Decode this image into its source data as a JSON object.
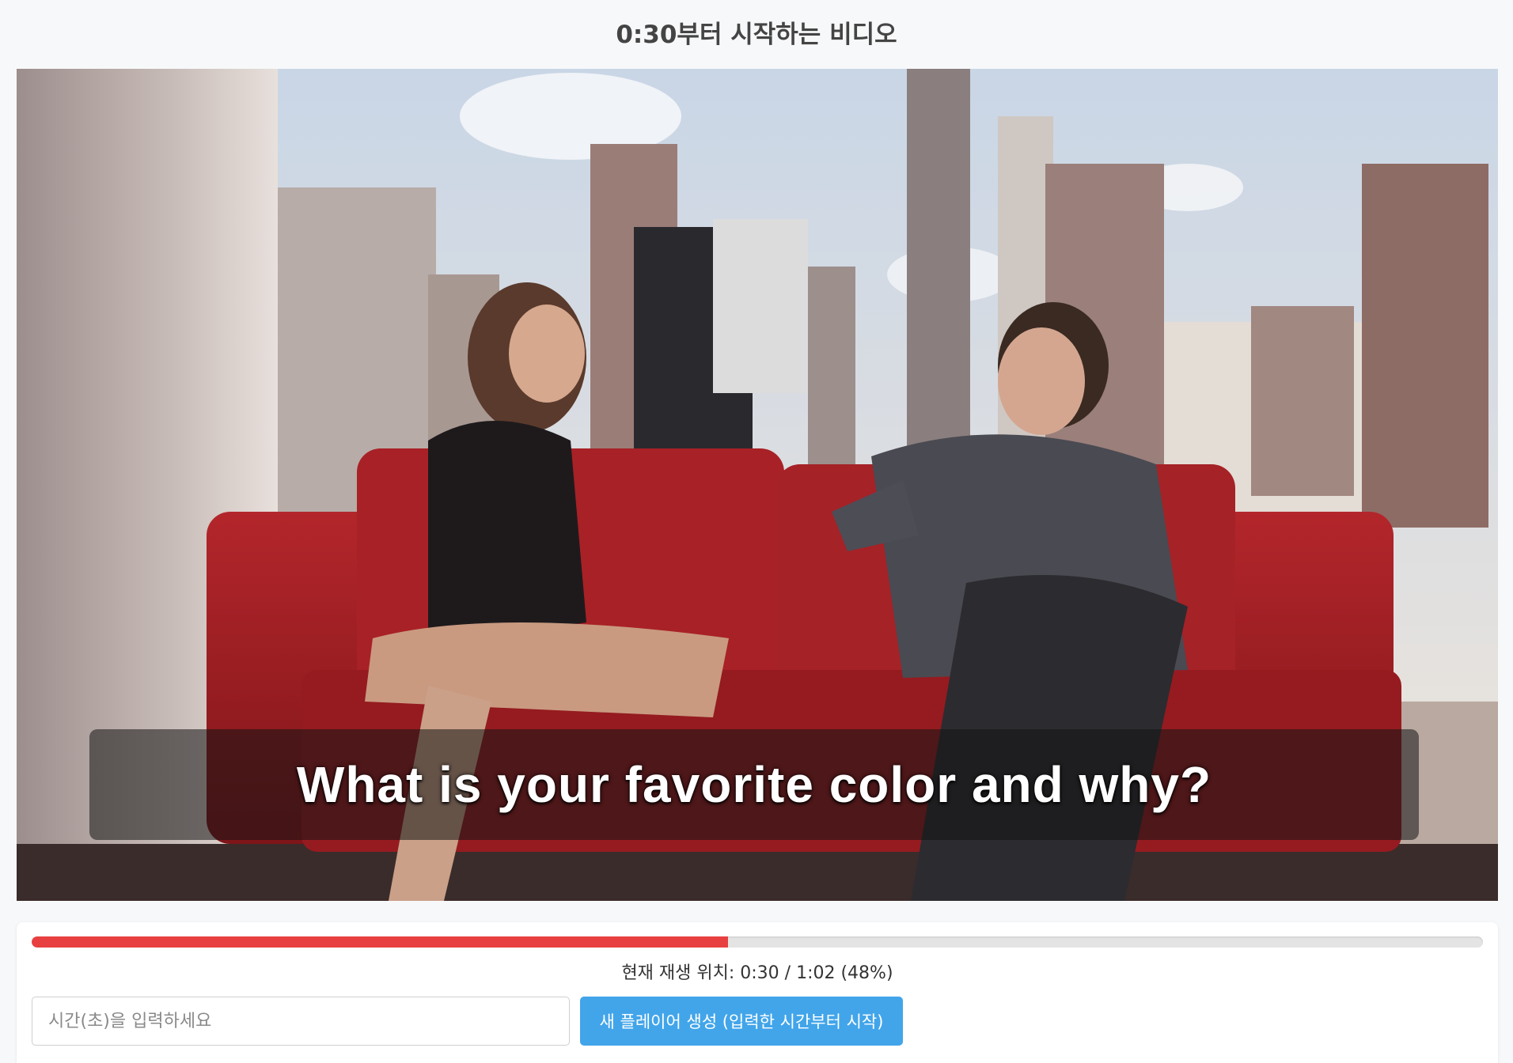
{
  "page": {
    "title": "0:30부터 시작하는 비디오"
  },
  "video": {
    "subtitle": "What is your favorite color and why?",
    "scene_description_icon": "video-frame"
  },
  "player": {
    "progress_percent": 48,
    "status_text": "현재 재생 위치: 0:30 / 1:02 (48%)",
    "current_time": "0:30",
    "duration": "1:02"
  },
  "controls": {
    "time_input": {
      "value": "",
      "placeholder": "시간(초)을 입력하세요"
    },
    "create_button_label": "새 플레이어 생성 (입력한 시간부터 시작)"
  },
  "colors": {
    "progress": "#e84040",
    "button": "#42a5ea",
    "background": "#f7f8fa"
  }
}
